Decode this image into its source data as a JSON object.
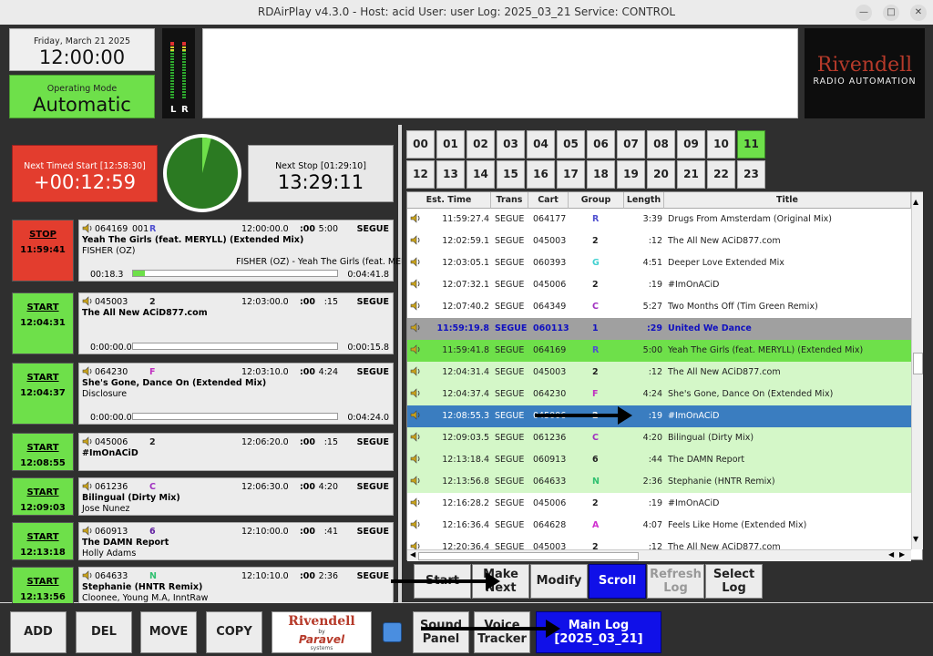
{
  "window": {
    "title": "RDAirPlay v4.3.0 - Host: acid User: user Log: 2025_03_21 Service: CONTROL"
  },
  "clock": {
    "date": "Friday, March 21 2025",
    "time": "12:00:00"
  },
  "mode": {
    "label": "Operating Mode",
    "value": "Automatic"
  },
  "meter": {
    "left": "L",
    "right": "R"
  },
  "logo": {
    "line1": "Rivendell",
    "line2": "RADIO AUTOMATION"
  },
  "next_timed": {
    "label": "Next Timed Start [12:58:30]",
    "value": "+00:12:59"
  },
  "next_stop": {
    "label": "Next Stop [01:29:10]",
    "value": "13:29:11"
  },
  "pie_remaining": 0.04,
  "carts": [
    {
      "btn1": "STOP",
      "btn2": "11:59:41",
      "btncolor": "#e33d2e",
      "cart": "064169",
      "line": "001",
      "group": "R",
      "gcolor": "#5050d0",
      "time": "12:00:00.0",
      "trans_t": ":00",
      "len": "5:00",
      "trans": "SEGUE",
      "title": "Yeah The Girls (feat. MERYLL) (Extended Mix)",
      "artist": "FISHER (OZ)",
      "meta": "FISHER (OZ) - Yeah The Girls (feat. MEI",
      "pos": "00:18.3",
      "remain": "0:04:41.8",
      "progress": 0.06,
      "height": 68
    },
    {
      "btn1": "START",
      "btn2": "12:04:31",
      "btncolor": "#6ee04a",
      "cart": "045003",
      "line": "",
      "group": "2",
      "gcolor": "#222",
      "time": "12:03:00.0",
      "trans_t": ":00",
      "len": ":15",
      "trans": "SEGUE",
      "title": "The All New ACiD877.com",
      "artist": "",
      "meta": "",
      "pos": "0:00:00.0",
      "remain": "0:00:15.8",
      "progress": 0.0,
      "height": 68
    },
    {
      "btn1": "START",
      "btn2": "12:04:37",
      "btncolor": "#6ee04a",
      "cart": "064230",
      "line": "",
      "group": "F",
      "gcolor": "#c030c0",
      "time": "12:03:10.0",
      "trans_t": ":00",
      "len": "4:24",
      "trans": "SEGUE",
      "title": "She's Gone, Dance On (Extended Mix)",
      "artist": "Disclosure",
      "meta": "",
      "pos": "0:00:00.0",
      "remain": "0:04:24.0",
      "progress": 0.0,
      "height": 68
    },
    {
      "btn1": "START",
      "btn2": "12:08:55",
      "btncolor": "#6ee04a",
      "cart": "045006",
      "line": "",
      "group": "2",
      "gcolor": "#222",
      "time": "12:06:20.0",
      "trans_t": ":00",
      "len": ":15",
      "trans": "SEGUE",
      "title": "#ImOnACiD",
      "artist": "",
      "meta": "",
      "pos": "",
      "remain": "",
      "progress": null,
      "height": 42
    },
    {
      "btn1": "START",
      "btn2": "12:09:03",
      "btncolor": "#6ee04a",
      "cart": "061236",
      "line": "",
      "group": "C",
      "gcolor": "#a030c0",
      "time": "12:06:30.0",
      "trans_t": ":00",
      "len": "4:20",
      "trans": "SEGUE",
      "title": "Bilingual (Dirty Mix)",
      "artist": "Jose Nunez",
      "meta": "",
      "pos": "",
      "remain": "",
      "progress": null,
      "height": 42
    },
    {
      "btn1": "START",
      "btn2": "12:13:18",
      "btncolor": "#6ee04a",
      "cart": "060913",
      "line": "",
      "group": "6",
      "gcolor": "#6020a0",
      "time": "12:10:00.0",
      "trans_t": ":00",
      "len": ":41",
      "trans": "SEGUE",
      "title": "The DAMN Report",
      "artist": "Holly Adams",
      "meta": "",
      "pos": "",
      "remain": "",
      "progress": null,
      "height": 42
    },
    {
      "btn1": "START",
      "btn2": "12:13:56",
      "btncolor": "#6ee04a",
      "cart": "064633",
      "line": "",
      "group": "N",
      "gcolor": "#30c070",
      "time": "12:10:10.0",
      "trans_t": ":00",
      "len": "2:36",
      "trans": "SEGUE",
      "title": "Stephanie (HNTR Remix)",
      "artist": "Cloonee, Young M.A, InntRaw",
      "meta": "",
      "pos": "",
      "remain": "",
      "progress": null,
      "height": 42
    }
  ],
  "hours": [
    "00",
    "01",
    "02",
    "03",
    "04",
    "05",
    "06",
    "07",
    "08",
    "09",
    "10",
    "11",
    "12",
    "13",
    "14",
    "15",
    "16",
    "17",
    "18",
    "19",
    "20",
    "21",
    "22",
    "23"
  ],
  "active_hour": "11",
  "log_columns": [
    "Est. Time",
    "Trans",
    "Cart",
    "Group",
    "Length",
    "Title"
  ],
  "log_rows": [
    {
      "time": "11:59:27.4",
      "trans": "SEGUE",
      "cart": "064177",
      "group": "R",
      "gcolor": "#5050d0",
      "len": "3:39",
      "title": "Drugs From Amsterdam (Original Mix)",
      "bg": "#ffffff",
      "fg": "#222222"
    },
    {
      "time": "12:02:59.1",
      "trans": "SEGUE",
      "cart": "045003",
      "group": "2",
      "gcolor": "#222222",
      "len": ":12",
      "title": "The All New ACiD877.com",
      "bg": "#ffffff",
      "fg": "#222222"
    },
    {
      "time": "12:03:05.1",
      "trans": "SEGUE",
      "cart": "060393",
      "group": "G",
      "gcolor": "#40d0d0",
      "len": "4:51",
      "title": "Deeper Love Extended Mix",
      "bg": "#ffffff",
      "fg": "#222222"
    },
    {
      "time": "12:07:32.1",
      "trans": "SEGUE",
      "cart": "045006",
      "group": "2",
      "gcolor": "#222222",
      "len": ":19",
      "title": "#ImOnACiD",
      "bg": "#ffffff",
      "fg": "#222222"
    },
    {
      "time": "12:07:40.2",
      "trans": "SEGUE",
      "cart": "064349",
      "group": "C",
      "gcolor": "#a030c0",
      "len": "5:27",
      "title": "Two Months Off (Tim Green Remix)",
      "bg": "#ffffff",
      "fg": "#222222"
    },
    {
      "time": "11:59:19.8",
      "trans": "SEGUE",
      "cart": "060113",
      "group": "1",
      "gcolor": "#1010c0",
      "len": ":29",
      "title": "United We Dance",
      "bg": "#a0a0a0",
      "fg": "#1010c0"
    },
    {
      "time": "11:59:41.8",
      "trans": "SEGUE",
      "cart": "064169",
      "group": "R",
      "gcolor": "#5050d0",
      "len": "5:00",
      "title": "Yeah The Girls (feat. MERYLL) (Extended Mix)",
      "bg": "#6ee04a",
      "fg": "#222222"
    },
    {
      "time": "12:04:31.4",
      "trans": "SEGUE",
      "cart": "045003",
      "group": "2",
      "gcolor": "#222222",
      "len": ":12",
      "title": "The All New ACiD877.com",
      "bg": "#d4f7c8",
      "fg": "#222222"
    },
    {
      "time": "12:04:37.4",
      "trans": "SEGUE",
      "cart": "064230",
      "group": "F",
      "gcolor": "#c030c0",
      "len": "4:24",
      "title": "She's Gone, Dance On (Extended Mix)",
      "bg": "#d4f7c8",
      "fg": "#222222"
    },
    {
      "time": "12:08:55.3",
      "trans": "SEGUE",
      "cart": "045006",
      "group": "2",
      "gcolor": "#ffffff",
      "len": ":19",
      "title": "#ImOnACiD",
      "bg": "#3a7dc0",
      "fg": "#ffffff"
    },
    {
      "time": "12:09:03.5",
      "trans": "SEGUE",
      "cart": "061236",
      "group": "C",
      "gcolor": "#a030c0",
      "len": "4:20",
      "title": "Bilingual (Dirty Mix)",
      "bg": "#d4f7c8",
      "fg": "#222222"
    },
    {
      "time": "12:13:18.4",
      "trans": "SEGUE",
      "cart": "060913",
      "group": "6",
      "gcolor": "#222222",
      "len": ":44",
      "title": "The DAMN Report",
      "bg": "#d4f7c8",
      "fg": "#222222"
    },
    {
      "time": "12:13:56.8",
      "trans": "SEGUE",
      "cart": "064633",
      "group": "N",
      "gcolor": "#30c070",
      "len": "2:36",
      "title": "Stephanie (HNTR Remix)",
      "bg": "#d4f7c8",
      "fg": "#222222"
    },
    {
      "time": "12:16:28.2",
      "trans": "SEGUE",
      "cart": "045006",
      "group": "2",
      "gcolor": "#222222",
      "len": ":19",
      "title": "#ImOnACiD",
      "bg": "#ffffff",
      "fg": "#222222"
    },
    {
      "time": "12:16:36.4",
      "trans": "SEGUE",
      "cart": "064628",
      "group": "A",
      "gcolor": "#d030d0",
      "len": "4:07",
      "title": "Feels Like Home (Extended Mix)",
      "bg": "#ffffff",
      "fg": "#222222"
    },
    {
      "time": "12:20:36.4",
      "trans": "SEGUE",
      "cart": "045003",
      "group": "2",
      "gcolor": "#222222",
      "len": ":12",
      "title": "The All New ACiD877.com",
      "bg": "#ffffff",
      "fg": "#222222"
    }
  ],
  "log_buttons": {
    "start": "Start",
    "make_next": "Make Next",
    "modify": "Modify",
    "scroll": "Scroll",
    "refresh": "Refresh Log",
    "select": "Select Log"
  },
  "bottom": {
    "add": "ADD",
    "del": "DEL",
    "move": "MOVE",
    "copy": "COPY",
    "sound_panel": "Sound Panel",
    "voice_tracker": "Voice Tracker",
    "main_log": "Main Log",
    "main_log_date": "[2025_03_21]",
    "paravel_line1": "Rivendell",
    "paravel_line2": "by",
    "paravel_line3": "Paravel",
    "paravel_line4": "systems"
  },
  "colors": {
    "green": "#6ee04a",
    "red": "#e33d2e",
    "blue_btn": "#1010e8",
    "selected_row": "#3a7dc0"
  }
}
